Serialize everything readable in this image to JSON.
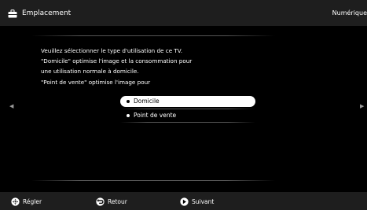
{
  "header": {
    "icon": "toolbox-icon",
    "title": "Emplacement",
    "right_label": "Numérique"
  },
  "description": {
    "lines": [
      "Veuillez sélectionner le type d'utilisation de ce TV.",
      "\"Domicile\" optimise l'image et la consommation pour",
      "une utilisation normale à domicile.",
      "\"Point de vente\" optimise l'image pour"
    ]
  },
  "options": [
    {
      "label": "Domicile",
      "selected": true
    },
    {
      "label": "Point de vente",
      "selected": false
    }
  ],
  "nav": {
    "left_arrow": "◀",
    "right_arrow": "▶"
  },
  "footer": {
    "items": [
      {
        "icon": "dpad-icon",
        "label": "Régler"
      },
      {
        "icon": "back-icon",
        "label": "Retour"
      },
      {
        "icon": "next-icon",
        "label": "Suivant"
      }
    ]
  },
  "colors": {
    "background": "#000000",
    "bar": "#1e1e1e",
    "selected_bg": "#ffffff",
    "text": "#ffffff"
  }
}
